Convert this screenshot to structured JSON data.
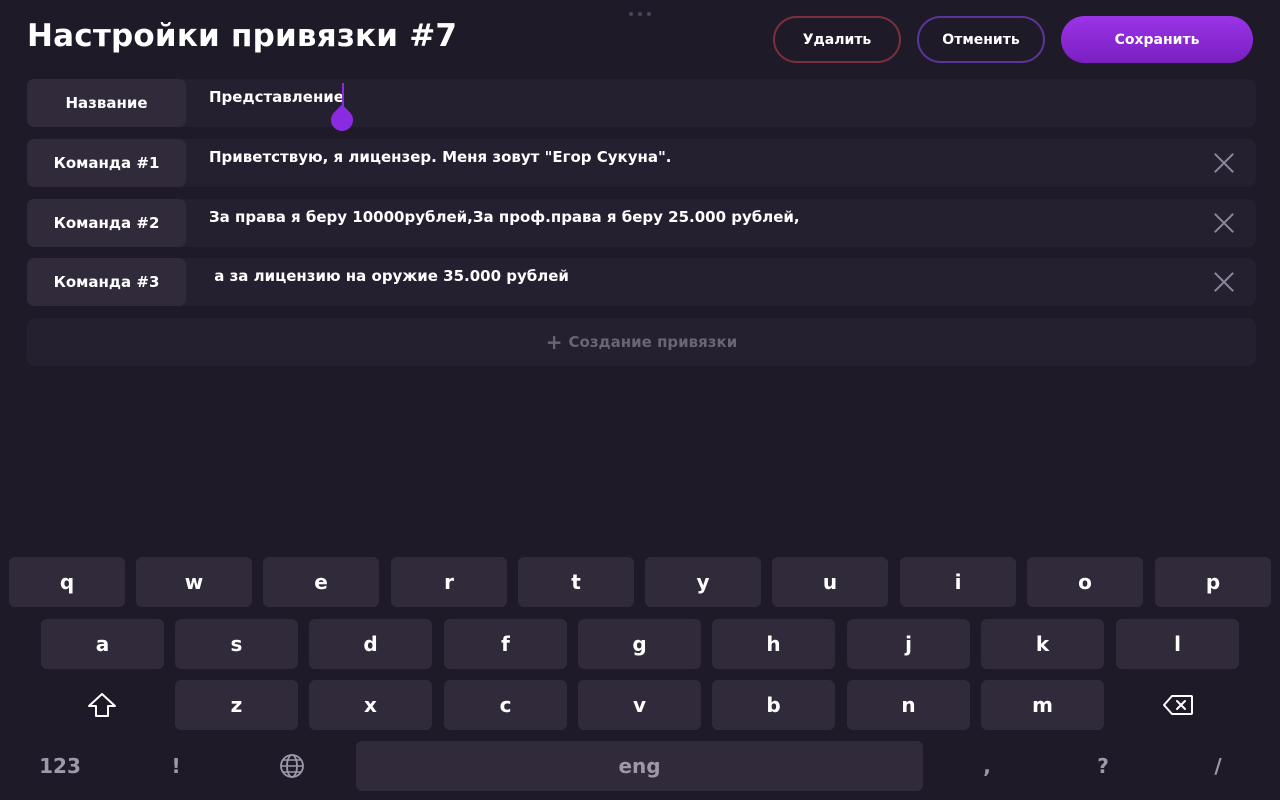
{
  "header": {
    "title": "Настройки привязки #7",
    "delete_label": "Удалить",
    "cancel_label": "Отменить",
    "save_label": "Сохранить"
  },
  "rows": [
    {
      "label": "Название",
      "value": "Представление",
      "removable": false
    },
    {
      "label": "Команда #1",
      "value": "Приветствую, я лицензер. Меня зовут \"Егор Сукуна\".",
      "removable": true
    },
    {
      "label": "Команда #2",
      "value": "За права я беру 10000рублей,За проф.права я беру 25.000 рублей,",
      "removable": true
    },
    {
      "label": "Команда #3",
      "value": " а за лицензию на оружие 35.000 рублей",
      "removable": true
    }
  ],
  "add_row": {
    "label": "Создание привязки",
    "icon": "plus-icon"
  },
  "keyboard": {
    "row1": [
      "q",
      "w",
      "e",
      "r",
      "t",
      "y",
      "u",
      "i",
      "o",
      "p"
    ],
    "row2": [
      "a",
      "s",
      "d",
      "f",
      "g",
      "h",
      "j",
      "k",
      "l"
    ],
    "row3": [
      "z",
      "x",
      "c",
      "v",
      "b",
      "n",
      "m"
    ],
    "numbers_label": "123",
    "exclaim_label": "!",
    "space_label": "eng",
    "comma_label": ",",
    "question_label": "?",
    "slash_label": "/",
    "shift_icon": "shift-icon",
    "backspace_icon": "backspace-icon",
    "globe_icon": "globe-icon"
  },
  "colors": {
    "background": "#1e1a27",
    "accent": "#8a2be2",
    "delete_border": "#7a2f3e",
    "cancel_border": "#5b3596"
  }
}
